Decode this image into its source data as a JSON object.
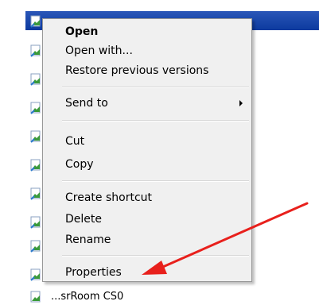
{
  "context_menu": {
    "items": [
      {
        "label": "Open",
        "bold": true
      },
      {
        "label": "Open with..."
      },
      {
        "label": "Restore previous versions"
      },
      {
        "label": "Send to",
        "has_submenu": true
      },
      {
        "label": "Cut"
      },
      {
        "label": "Copy"
      },
      {
        "label": "Create shortcut"
      },
      {
        "label": "Delete"
      },
      {
        "label": "Rename"
      },
      {
        "label": "Properties"
      }
    ]
  },
  "background_file": {
    "label": "...srRoom CS0"
  },
  "colors": {
    "selection": "#0c3a9e",
    "annotation_arrow": "#e8201c",
    "menu_bg": "#f0f0f0"
  },
  "icons": {
    "file_icon": "shortcut-file-icon",
    "annotation": "red-arrow-annotation"
  }
}
